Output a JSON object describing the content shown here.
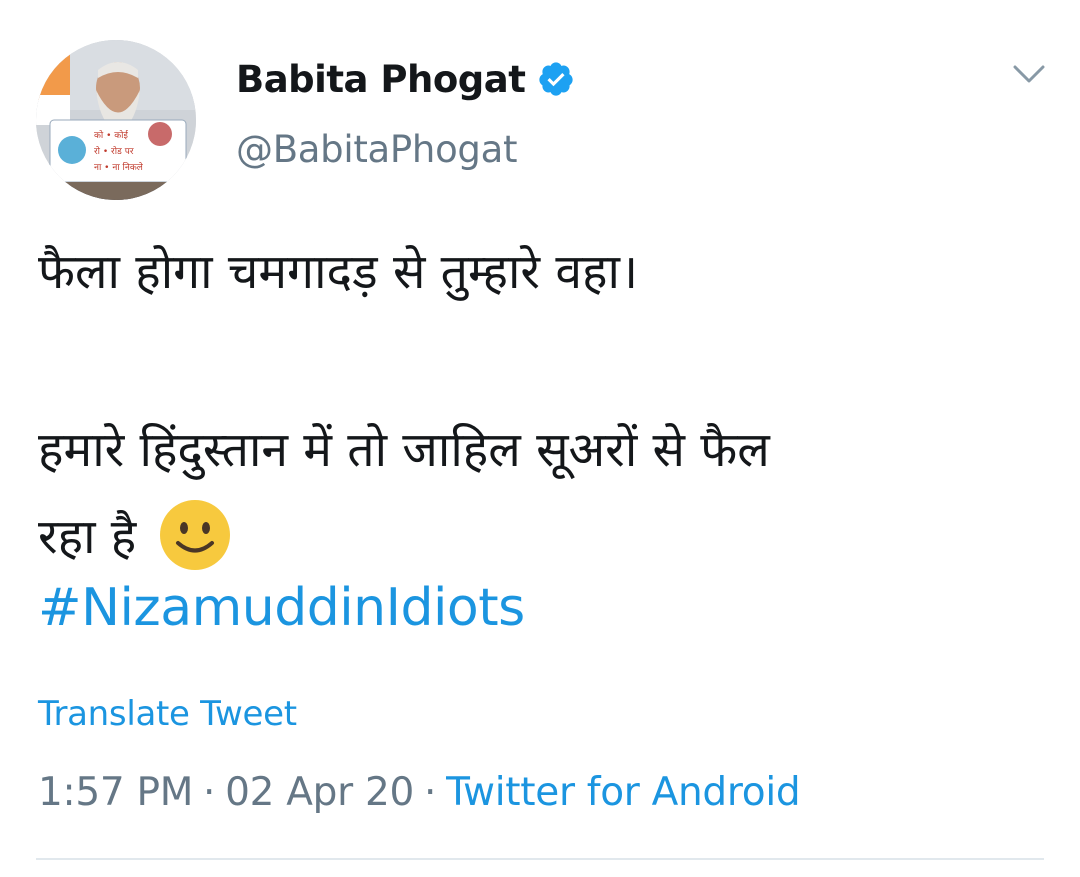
{
  "tweet": {
    "author": {
      "display_name": "Babita Phogat",
      "handle": "@BabitaPhogat",
      "verified": true,
      "avatar_icon": "profile-avatar",
      "avatar_sign_text": "को • कोई रो • रोड पर ना • ना निकले"
    },
    "text": {
      "line1": "फैला होगा चमगादड़ से तुम्हारे वहा।",
      "line2": "हमारे हिंदुस्तान में तो जाहिल सूअरों से फैल",
      "line3": "रहा है",
      "emoji": "slightly-smiling-face-icon",
      "hashtag": "#NizamuddinIdiots"
    },
    "translate_label": "Translate Tweet",
    "time": "1:57 PM",
    "date": "02 Apr 20",
    "separator": "·",
    "source": "Twitter for Android",
    "colors": {
      "link": "#1b95e0",
      "secondary_text": "#657786",
      "primary_text": "#14171a",
      "verified_badge": "#1da1f2",
      "divider": "#e1e8ed"
    }
  }
}
